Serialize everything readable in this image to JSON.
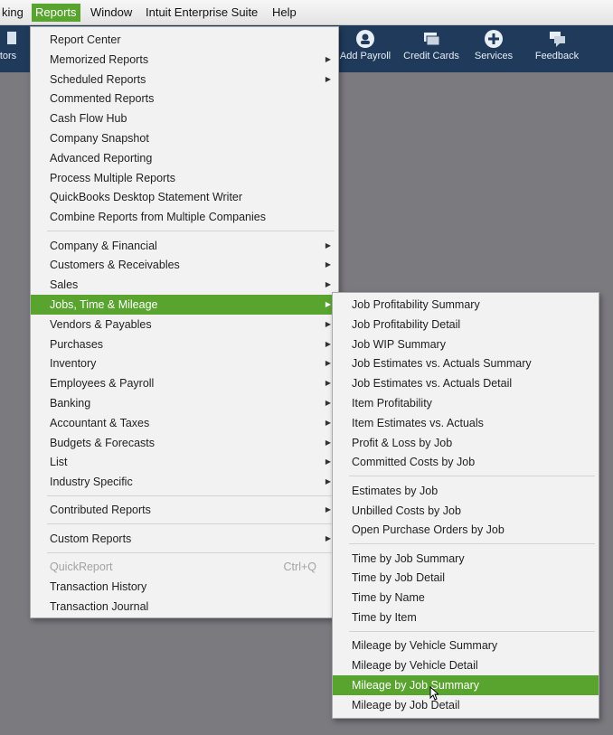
{
  "menubar": {
    "items": [
      "king",
      "Reports",
      "Window",
      "Intuit Enterprise Suite",
      "Help"
    ]
  },
  "toolbar": {
    "items": [
      {
        "label": "tors",
        "icon": "vendors-icon"
      },
      {
        "label": "Add Payroll",
        "icon": "payroll-icon"
      },
      {
        "label": "Credit Cards",
        "icon": "credit-card-icon"
      },
      {
        "label": "Services",
        "icon": "plus-circle-icon"
      },
      {
        "label": "Feedback",
        "icon": "feedback-icon"
      }
    ]
  },
  "reports_menu": {
    "group1": [
      "Report Center",
      "Memorized Reports",
      "Scheduled Reports",
      "Commented Reports",
      "Cash Flow Hub",
      "Company Snapshot",
      "Advanced Reporting",
      "Process Multiple Reports",
      "QuickBooks Desktop Statement Writer",
      "Combine Reports from Multiple Companies"
    ],
    "group2": [
      "Company & Financial",
      "Customers & Receivables",
      "Sales",
      "Jobs, Time & Mileage",
      "Vendors & Payables",
      "Purchases",
      "Inventory",
      "Employees & Payroll",
      "Banking",
      "Accountant & Taxes",
      "Budgets & Forecasts",
      "List",
      "Industry Specific"
    ],
    "group3": [
      "Contributed Reports"
    ],
    "group4": [
      "Custom Reports"
    ],
    "group5": [
      "QuickReport",
      "Transaction History",
      "Transaction Journal"
    ],
    "quickreport_shortcut": "Ctrl+Q"
  },
  "jobs_submenu": {
    "group1": [
      "Job Profitability Summary",
      "Job Profitability Detail",
      "Job WIP Summary",
      "Job Estimates vs. Actuals Summary",
      "Job Estimates vs. Actuals Detail",
      "Item Profitability",
      "Item Estimates vs. Actuals",
      "Profit & Loss by Job",
      "Committed Costs by Job"
    ],
    "group2": [
      "Estimates by Job",
      "Unbilled Costs by Job",
      "Open Purchase Orders by Job"
    ],
    "group3": [
      "Time by Job Summary",
      "Time by Job Detail",
      "Time by Name",
      "Time by Item"
    ],
    "group4": [
      "Mileage by Vehicle Summary",
      "Mileage by Vehicle Detail",
      "Mileage by Job Summary",
      "Mileage by Job Detail"
    ]
  },
  "colors": {
    "highlight": "#58a42f",
    "toolbar": "#1f3a5a",
    "desktop": "#7b7a7f"
  }
}
